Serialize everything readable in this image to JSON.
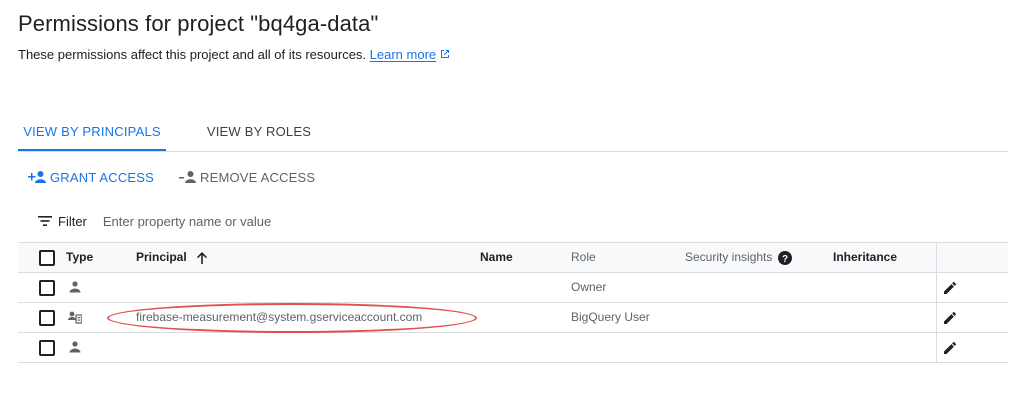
{
  "header": {
    "title": "Permissions for project \"bq4ga-data\"",
    "subtitle": "These permissions affect this project and all of its resources.",
    "learn_more": "Learn more"
  },
  "tabs": [
    {
      "label": "VIEW BY PRINCIPALS",
      "active": true
    },
    {
      "label": "VIEW BY ROLES",
      "active": false
    }
  ],
  "actions": {
    "grant": "GRANT ACCESS",
    "remove": "REMOVE ACCESS"
  },
  "filter": {
    "label": "Filter",
    "placeholder": "Enter property name or value"
  },
  "table": {
    "columns": {
      "type": "Type",
      "principal": "Principal",
      "name": "Name",
      "role": "Role",
      "security_insights": "Security insights",
      "inheritance": "Inheritance"
    },
    "rows": [
      {
        "type_icon": "person-icon",
        "principal": "",
        "name": "",
        "role": "Owner",
        "inheritance": ""
      },
      {
        "type_icon": "service-account-icon",
        "principal": "firebase-measurement@system.gserviceaccount.com",
        "name": "",
        "role": "BigQuery User",
        "inheritance": ""
      },
      {
        "type_icon": "person-icon",
        "principal": "",
        "name": "",
        "role": "",
        "inheritance": ""
      }
    ]
  },
  "colors": {
    "accent": "#1a73e8",
    "highlight_ellipse": "#e0504e"
  }
}
